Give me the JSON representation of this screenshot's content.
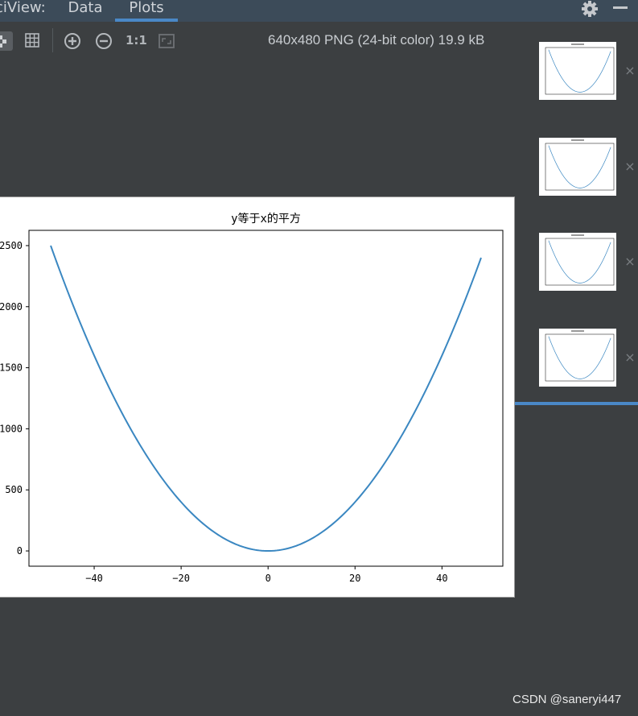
{
  "header": {
    "title": "ciView:",
    "tabs": [
      {
        "label": "Data",
        "active": false
      },
      {
        "label": "Plots",
        "active": true
      }
    ]
  },
  "toolbar": {
    "one_to_one_label": "1:1",
    "image_info": "640x480 PNG (24-bit color) 19.9 kB"
  },
  "thumbnails": [
    {
      "index": 1,
      "close_glyph": "×"
    },
    {
      "index": 2,
      "close_glyph": "×"
    },
    {
      "index": 3,
      "close_glyph": "×"
    },
    {
      "index": 4,
      "close_glyph": "×",
      "selected": true
    }
  ],
  "colors": {
    "background": "#3c3f41",
    "tabbar": "#3c4b59",
    "accent": "#4a88c7",
    "line": "#3a87c1"
  },
  "watermark": "CSDN @saneryi447",
  "chart_data": {
    "type": "line",
    "title": "y等于x的平方",
    "xlabel": "",
    "ylabel": "",
    "x_ticks": [
      -40,
      -20,
      0,
      20,
      40
    ],
    "y_ticks": [
      0,
      500,
      1000,
      1500,
      2000,
      2500
    ],
    "y_tick_labels": [
      "0",
      "500",
      "1000",
      "1500",
      "2000",
      "2500"
    ],
    "x_range": [
      -50,
      49
    ],
    "xlim": [
      -55,
      54
    ],
    "ylim": [
      -125,
      2625
    ],
    "series": [
      {
        "function": "y = x^2",
        "x_start": -50,
        "x_end": 49
      }
    ],
    "grid": false
  }
}
